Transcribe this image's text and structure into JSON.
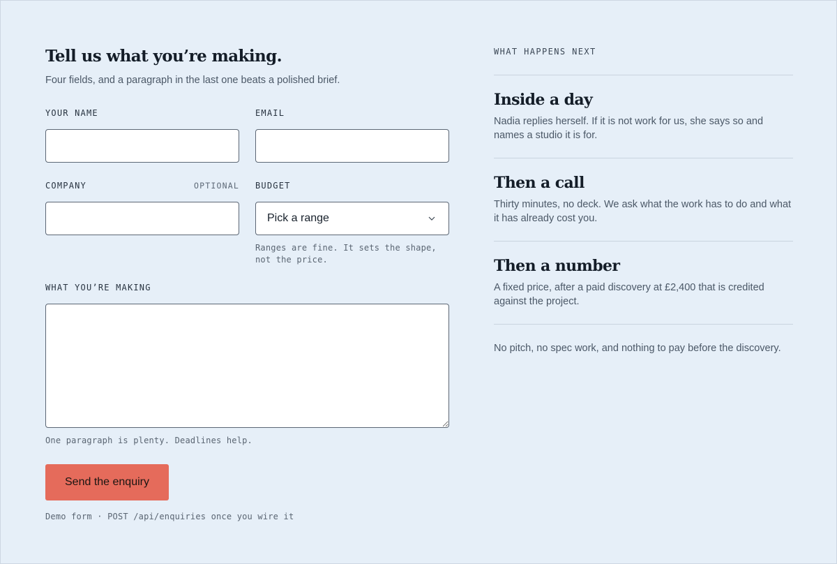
{
  "form": {
    "title": "Tell us what you’re making.",
    "subtitle": "Four fields, and a paragraph in the last one beats a polished brief.",
    "name": {
      "label": "YOUR NAME",
      "value": ""
    },
    "email": {
      "label": "EMAIL",
      "value": ""
    },
    "company": {
      "label": "COMPANY",
      "optional": "OPTIONAL",
      "value": ""
    },
    "budget": {
      "label": "BUDGET",
      "selected": "Pick a range",
      "hint": "Ranges are fine. It sets the shape, not the price."
    },
    "making": {
      "label": "WHAT YOU’RE MAKING",
      "value": "",
      "hint": "One paragraph is plenty. Deadlines help."
    },
    "submit_label": "Send the enquiry",
    "demo_note": "Demo form · POST /api/enquiries once you wire it"
  },
  "side": {
    "heading": "WHAT HAPPENS NEXT",
    "steps": [
      {
        "title": "Inside a day",
        "body": "Nadia replies herself. If it is not work for us, she says so and names a studio it is for."
      },
      {
        "title": "Then a call",
        "body": "Thirty minutes, no deck. We ask what the work has to do and what it has already cost you."
      },
      {
        "title": "Then a number",
        "body": "A fixed price, after a paid discovery at £2,400 that is credited against the project."
      }
    ],
    "footer": "No pitch, no spec work, and nothing to pay before the discovery."
  },
  "colors": {
    "background": "#e6eff8",
    "accent": "#e56b5b",
    "ink": "#141d28",
    "muted": "#4b5867"
  },
  "icons": {
    "budget_select": "chevron-down-icon"
  }
}
